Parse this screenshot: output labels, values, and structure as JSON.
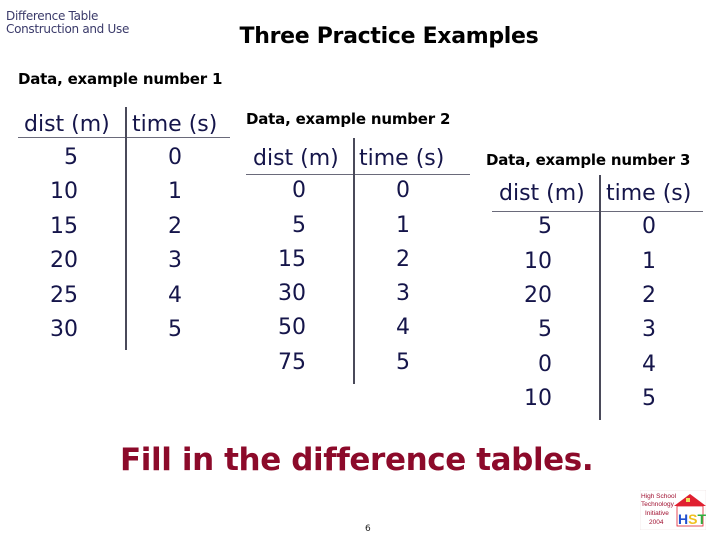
{
  "header": {
    "corner_title_line1": "Difference Table",
    "corner_title_line2": "Construction and Use",
    "main_title": "Three Practice Examples"
  },
  "examples": [
    {
      "label": "Data, example number 1",
      "columns": [
        "dist (m)",
        "time (s)"
      ],
      "rows": [
        [
          "5",
          "0"
        ],
        [
          "10",
          "1"
        ],
        [
          "15",
          "2"
        ],
        [
          "20",
          "3"
        ],
        [
          "25",
          "4"
        ],
        [
          "30",
          "5"
        ]
      ]
    },
    {
      "label": "Data, example number 2",
      "columns": [
        "dist (m)",
        "time (s)"
      ],
      "rows": [
        [
          "0",
          "0"
        ],
        [
          "5",
          "1"
        ],
        [
          "15",
          "2"
        ],
        [
          "30",
          "3"
        ],
        [
          "50",
          "4"
        ],
        [
          "75",
          "5"
        ]
      ]
    },
    {
      "label": "Data, example number 3",
      "columns": [
        "dist (m)",
        "time (s)"
      ],
      "rows": [
        [
          "5",
          "0"
        ],
        [
          "10",
          "1"
        ],
        [
          "20",
          "2"
        ],
        [
          "5",
          "3"
        ],
        [
          "0",
          "4"
        ],
        [
          "10",
          "5"
        ]
      ]
    }
  ],
  "instruction": "Fill in the difference tables.",
  "footer": {
    "page_number": "6",
    "logo_text": [
      "High School",
      "Technology",
      "Initiative",
      "2004"
    ],
    "logo_letters": "HSTi"
  },
  "colors": {
    "instruction": "#8c0a2a",
    "table_text": "#15154a",
    "corner_title": "#3a3a6a"
  }
}
